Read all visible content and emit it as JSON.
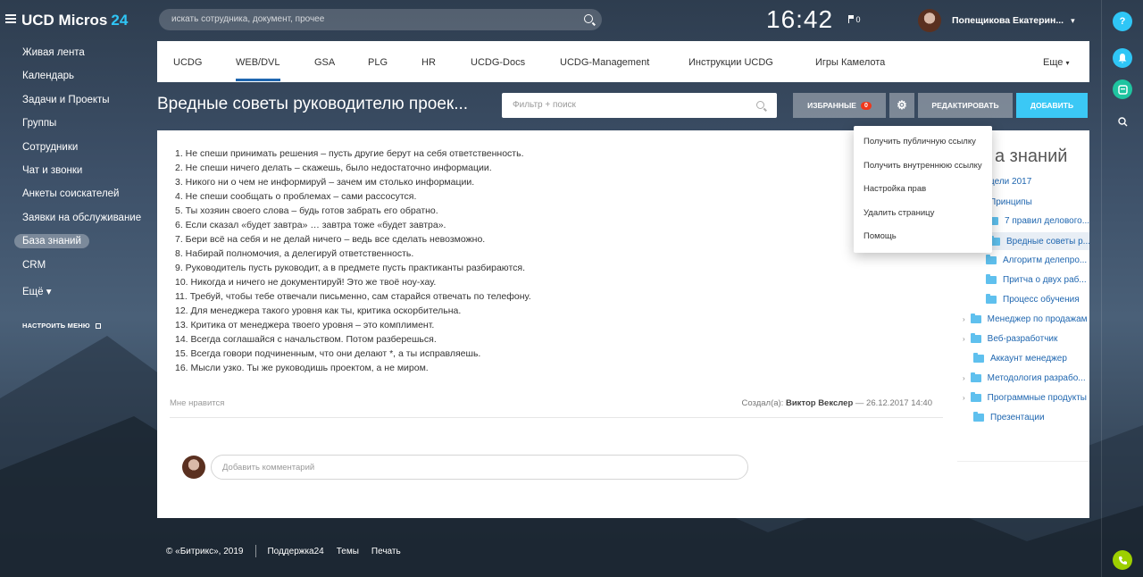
{
  "header": {
    "logo": "UCD Micros",
    "logo_num": "24",
    "search_placeholder": "искать сотрудника, документ, прочее",
    "clock": "16:42",
    "flag_count": "0",
    "user_name": "Попещикова Екатерин..."
  },
  "leftmenu": {
    "items": [
      "Живая лента",
      "Календарь",
      "Задачи и Проекты",
      "Группы",
      "Сотрудники",
      "Чат и звонки",
      "Анкеты соискателей",
      "Заявки на обслуживание",
      "База знаний",
      "CRM",
      "Ещё"
    ],
    "active_index": 8,
    "more_arrow": "▾",
    "config": "НАСТРОИТЬ МЕНЮ"
  },
  "rightbar": {
    "help": "?"
  },
  "tabs": {
    "items": [
      "UCDG",
      "WEB/DVL",
      "GSA",
      "PLG",
      "HR",
      "UCDG-Docs",
      "UCDG-Management",
      "Инструкции UCDG",
      "Игры Камелота"
    ],
    "active_index": 1,
    "more": "Еще"
  },
  "page": {
    "title": "Вредные советы руководителю проек...",
    "filter_placeholder": "Фильтр + поиск",
    "btn_fav": "Избранные",
    "fav_count": "0",
    "btn_edit": "Редактировать",
    "btn_add": "Добавить"
  },
  "article": {
    "items": [
      "1. Не спеши принимать решения – пусть другие берут на себя ответственность.",
      "2. Не спеши ничего делать – скажешь, было недостаточно информации.",
      "3. Никого ни о чем не информируй – зачем им столько информации.",
      "4. Не спеши сообщать о проблемах – сами рассосутся.",
      "5. Ты хозяин своего слова – будь готов забрать его обратно.",
      "6. Если сказал «будет завтра» … завтра тоже «будет завтра».",
      "7. Бери всё на себя и не делай ничего – ведь все сделать невозможно.",
      "8. Набирай полномочия, а делегируй ответственность.",
      "9. Руководитель пусть руководит, а в предмете пусть практиканты разбираются.",
      "10. Никогда и ничего не документируй! Это же твоё ноу-хау.",
      "11. Требуй, чтобы тебе отвечали письменно, сам старайся отвечать по телефону.",
      "12. Для менеджера такого уровня как ты, критика оскорбительна.",
      "13. Критика от менеджера твоего уровня – это комплимент.",
      "14. Всегда соглашайся с начальством. Потом разберешься.",
      "15. Всегда говори подчиненным, что они делают *, а ты исправляешь.",
      "16. Мысли узко. Ты же руководишь проектом, а не миром."
    ],
    "like": "Мне нравится",
    "created_prefix": "Создал(а):",
    "created_author": "Виктор Векслер",
    "created_date": "— 26.12.2017 14:40",
    "comment_placeholder": "Добавить комментарий"
  },
  "tree": {
    "title_partial": "а знаний",
    "items": [
      {
        "label": "цели 2017",
        "level": 0,
        "icon": "none"
      },
      {
        "label": "Принципы",
        "level": 0,
        "icon": "none"
      },
      {
        "label": "7 правил делового...",
        "level": 1,
        "icon": "folder"
      },
      {
        "label": "Вредные советы р...",
        "level": 1,
        "icon": "folder",
        "active": true
      },
      {
        "label": "Алгоритм делепро...",
        "level": 1,
        "icon": "folder"
      },
      {
        "label": "Притча о двух раб...",
        "level": 1,
        "icon": "folder"
      },
      {
        "label": "Процесс обучения",
        "level": 1,
        "icon": "folder"
      },
      {
        "label": "Менеджер по продажам",
        "level": 0,
        "icon": "folder",
        "arrow": "›"
      },
      {
        "label": "Веб-разработчик",
        "level": 0,
        "icon": "folder",
        "arrow": "›"
      },
      {
        "label": "Аккаунт менеджер",
        "level": 0,
        "icon": "folder"
      },
      {
        "label": "Методология разрабо...",
        "level": 0,
        "icon": "folder",
        "arrow": "›"
      },
      {
        "label": "Программные продукты",
        "level": 0,
        "icon": "folder",
        "arrow": "›"
      },
      {
        "label": "Презентации",
        "level": 0,
        "icon": "folder"
      }
    ]
  },
  "dropdown": {
    "items": [
      "Получить публичную ссылку",
      "Получить внутреннюю ссылку",
      "Настройка прав",
      "Удалить страницу",
      "Помощь"
    ]
  },
  "footer": {
    "copyright": "© «Битрикс», 2019",
    "support": "Поддержка24",
    "themes": "Темы",
    "print": "Печать"
  },
  "colors": {
    "accent": "#2fc6f6",
    "add_button": "#3bc8f5",
    "badge": "#f0371b",
    "link": "#2067b0"
  }
}
